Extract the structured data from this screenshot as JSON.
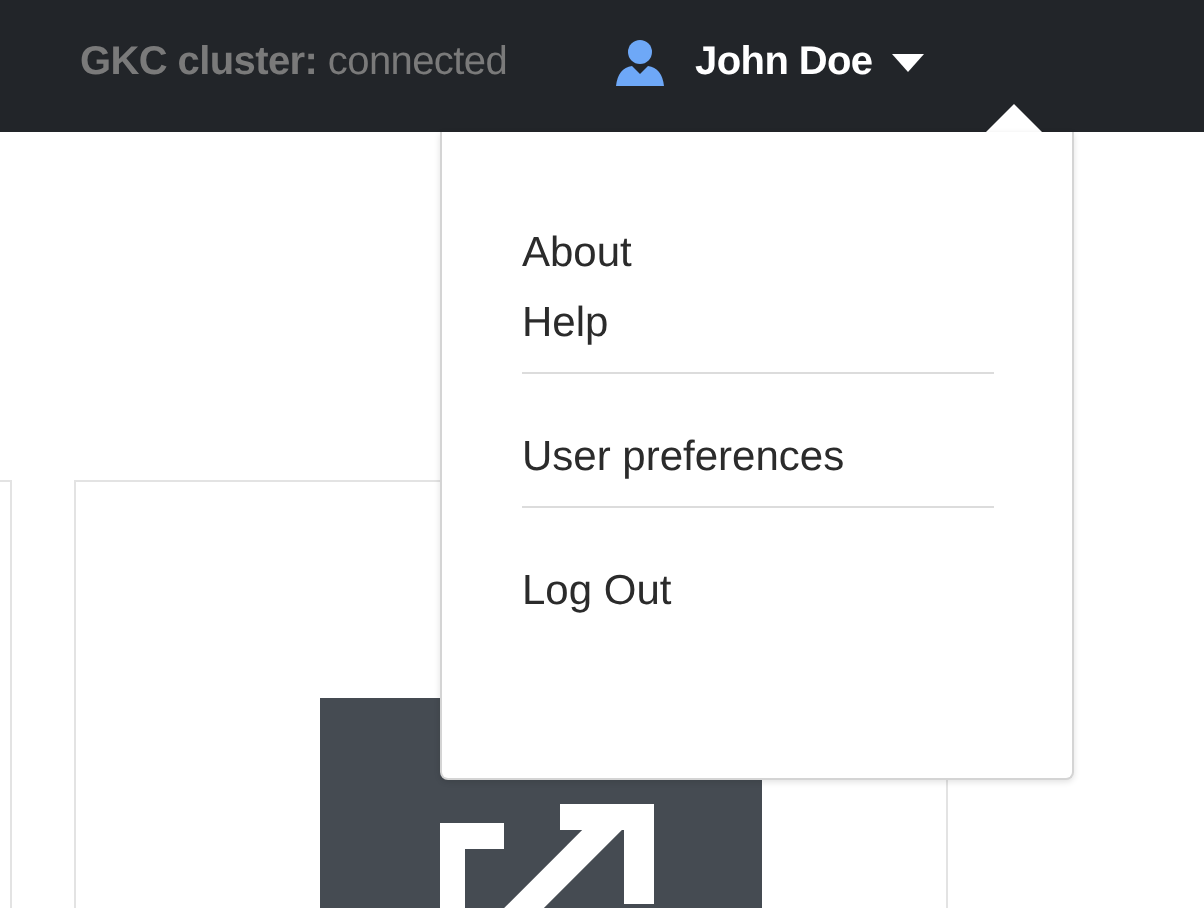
{
  "header": {
    "cluster_label": "GKC cluster:",
    "cluster_status": "connected",
    "user": {
      "name": "John Doe",
      "expanded": true
    }
  },
  "user_menu": [
    {
      "kind": "item",
      "label": "About"
    },
    {
      "kind": "item",
      "label": "Help"
    },
    {
      "kind": "divider"
    },
    {
      "kind": "item",
      "label": "User preferences"
    },
    {
      "kind": "divider"
    },
    {
      "kind": "item",
      "label": "Log Out"
    }
  ]
}
